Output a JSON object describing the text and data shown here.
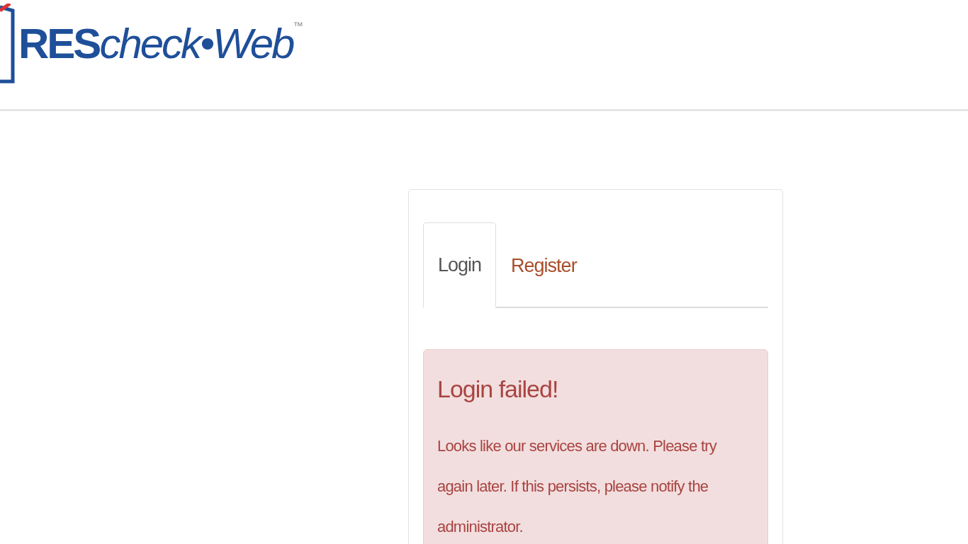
{
  "logo": {
    "text": "**RES**check•Web$^{™}$"
  },
  "tabs": [
    {
      "label": "Login",
      "selected": true
    },
    {
      "label": "Register",
      "selected": false
    }
  ],
  "alert": {
    "kind": "danger",
    "title": "Login failed!",
    "message": "Looks like our services are down. Please try again later. If this persists, please notify the administrator."
  }
}
